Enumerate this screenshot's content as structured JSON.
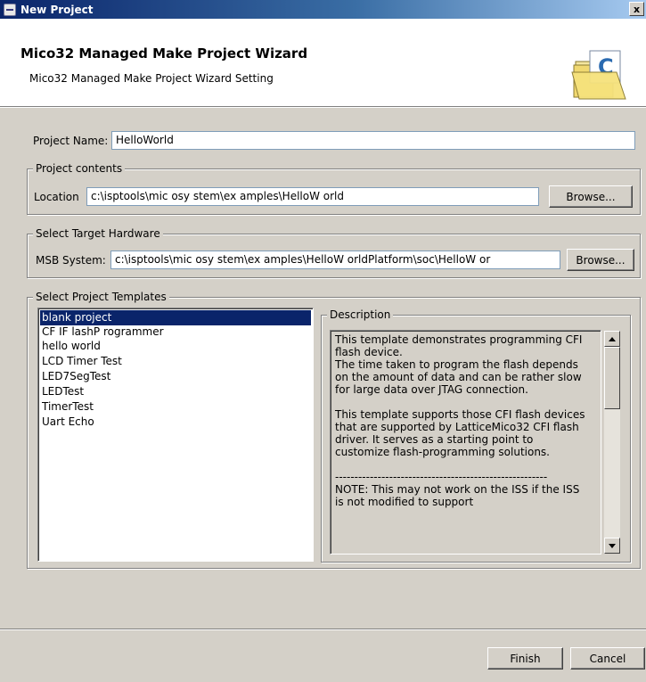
{
  "window": {
    "title": "New Project",
    "close_label": "x"
  },
  "wizard": {
    "title": "Mico32 Managed Make Project Wizard",
    "description": "Mico32 Managed Make Project Wizard Setting",
    "image_icon": "folder-c-icon"
  },
  "project_name": {
    "label": "Project Name:",
    "value": "HelloWorld"
  },
  "project_contents": {
    "legend": "Project contents",
    "location_label": "Location",
    "location_value": "c:\\isptools\\mic osy stem\\ex amples\\HelloW orld",
    "browse_label": "Browse..."
  },
  "target_hardware": {
    "legend": "Select Target Hardware",
    "msb_label": "MSB System:",
    "msb_value": "c:\\isptools\\mic osy stem\\ex amples\\HelloW orldPlatform\\soc\\HelloW or",
    "browse_label": "Browse..."
  },
  "templates": {
    "legend": "Select Project Templates",
    "items": [
      {
        "label": "blank project",
        "selected": true
      },
      {
        "label": "CF IF lashP rogrammer",
        "selected": false
      },
      {
        "label": "hello world",
        "selected": false
      },
      {
        "label": "LCD Timer Test",
        "selected": false
      },
      {
        "label": "LED7SegTest",
        "selected": false
      },
      {
        "label": "LEDTest",
        "selected": false
      },
      {
        "label": "TimerTest",
        "selected": false
      },
      {
        "label": "Uart Echo",
        "selected": false
      }
    ]
  },
  "description": {
    "legend": "Description",
    "para1": "This template demonstrates programming CFI\nflash device.\nThe time taken to program the flash depends\non the amount of data and can be rather slow\nfor large data over JTAG connection.",
    "para2": "This template supports those CFI flash devices\nthat are supported by LatticeMico32 CFI flash\ndriver.  It serves as a starting point to\ncustomize flash-programming solutions.",
    "para3": "-------------------------------------------------------\nNOTE: This may not work on the ISS if the ISS\nis not modified to support"
  },
  "buttons": {
    "finish": "Finish",
    "cancel": "Cancel"
  },
  "colors": {
    "selection": "#0a246a",
    "titlebar": "#0a246a",
    "face": "#d4d0c8"
  }
}
